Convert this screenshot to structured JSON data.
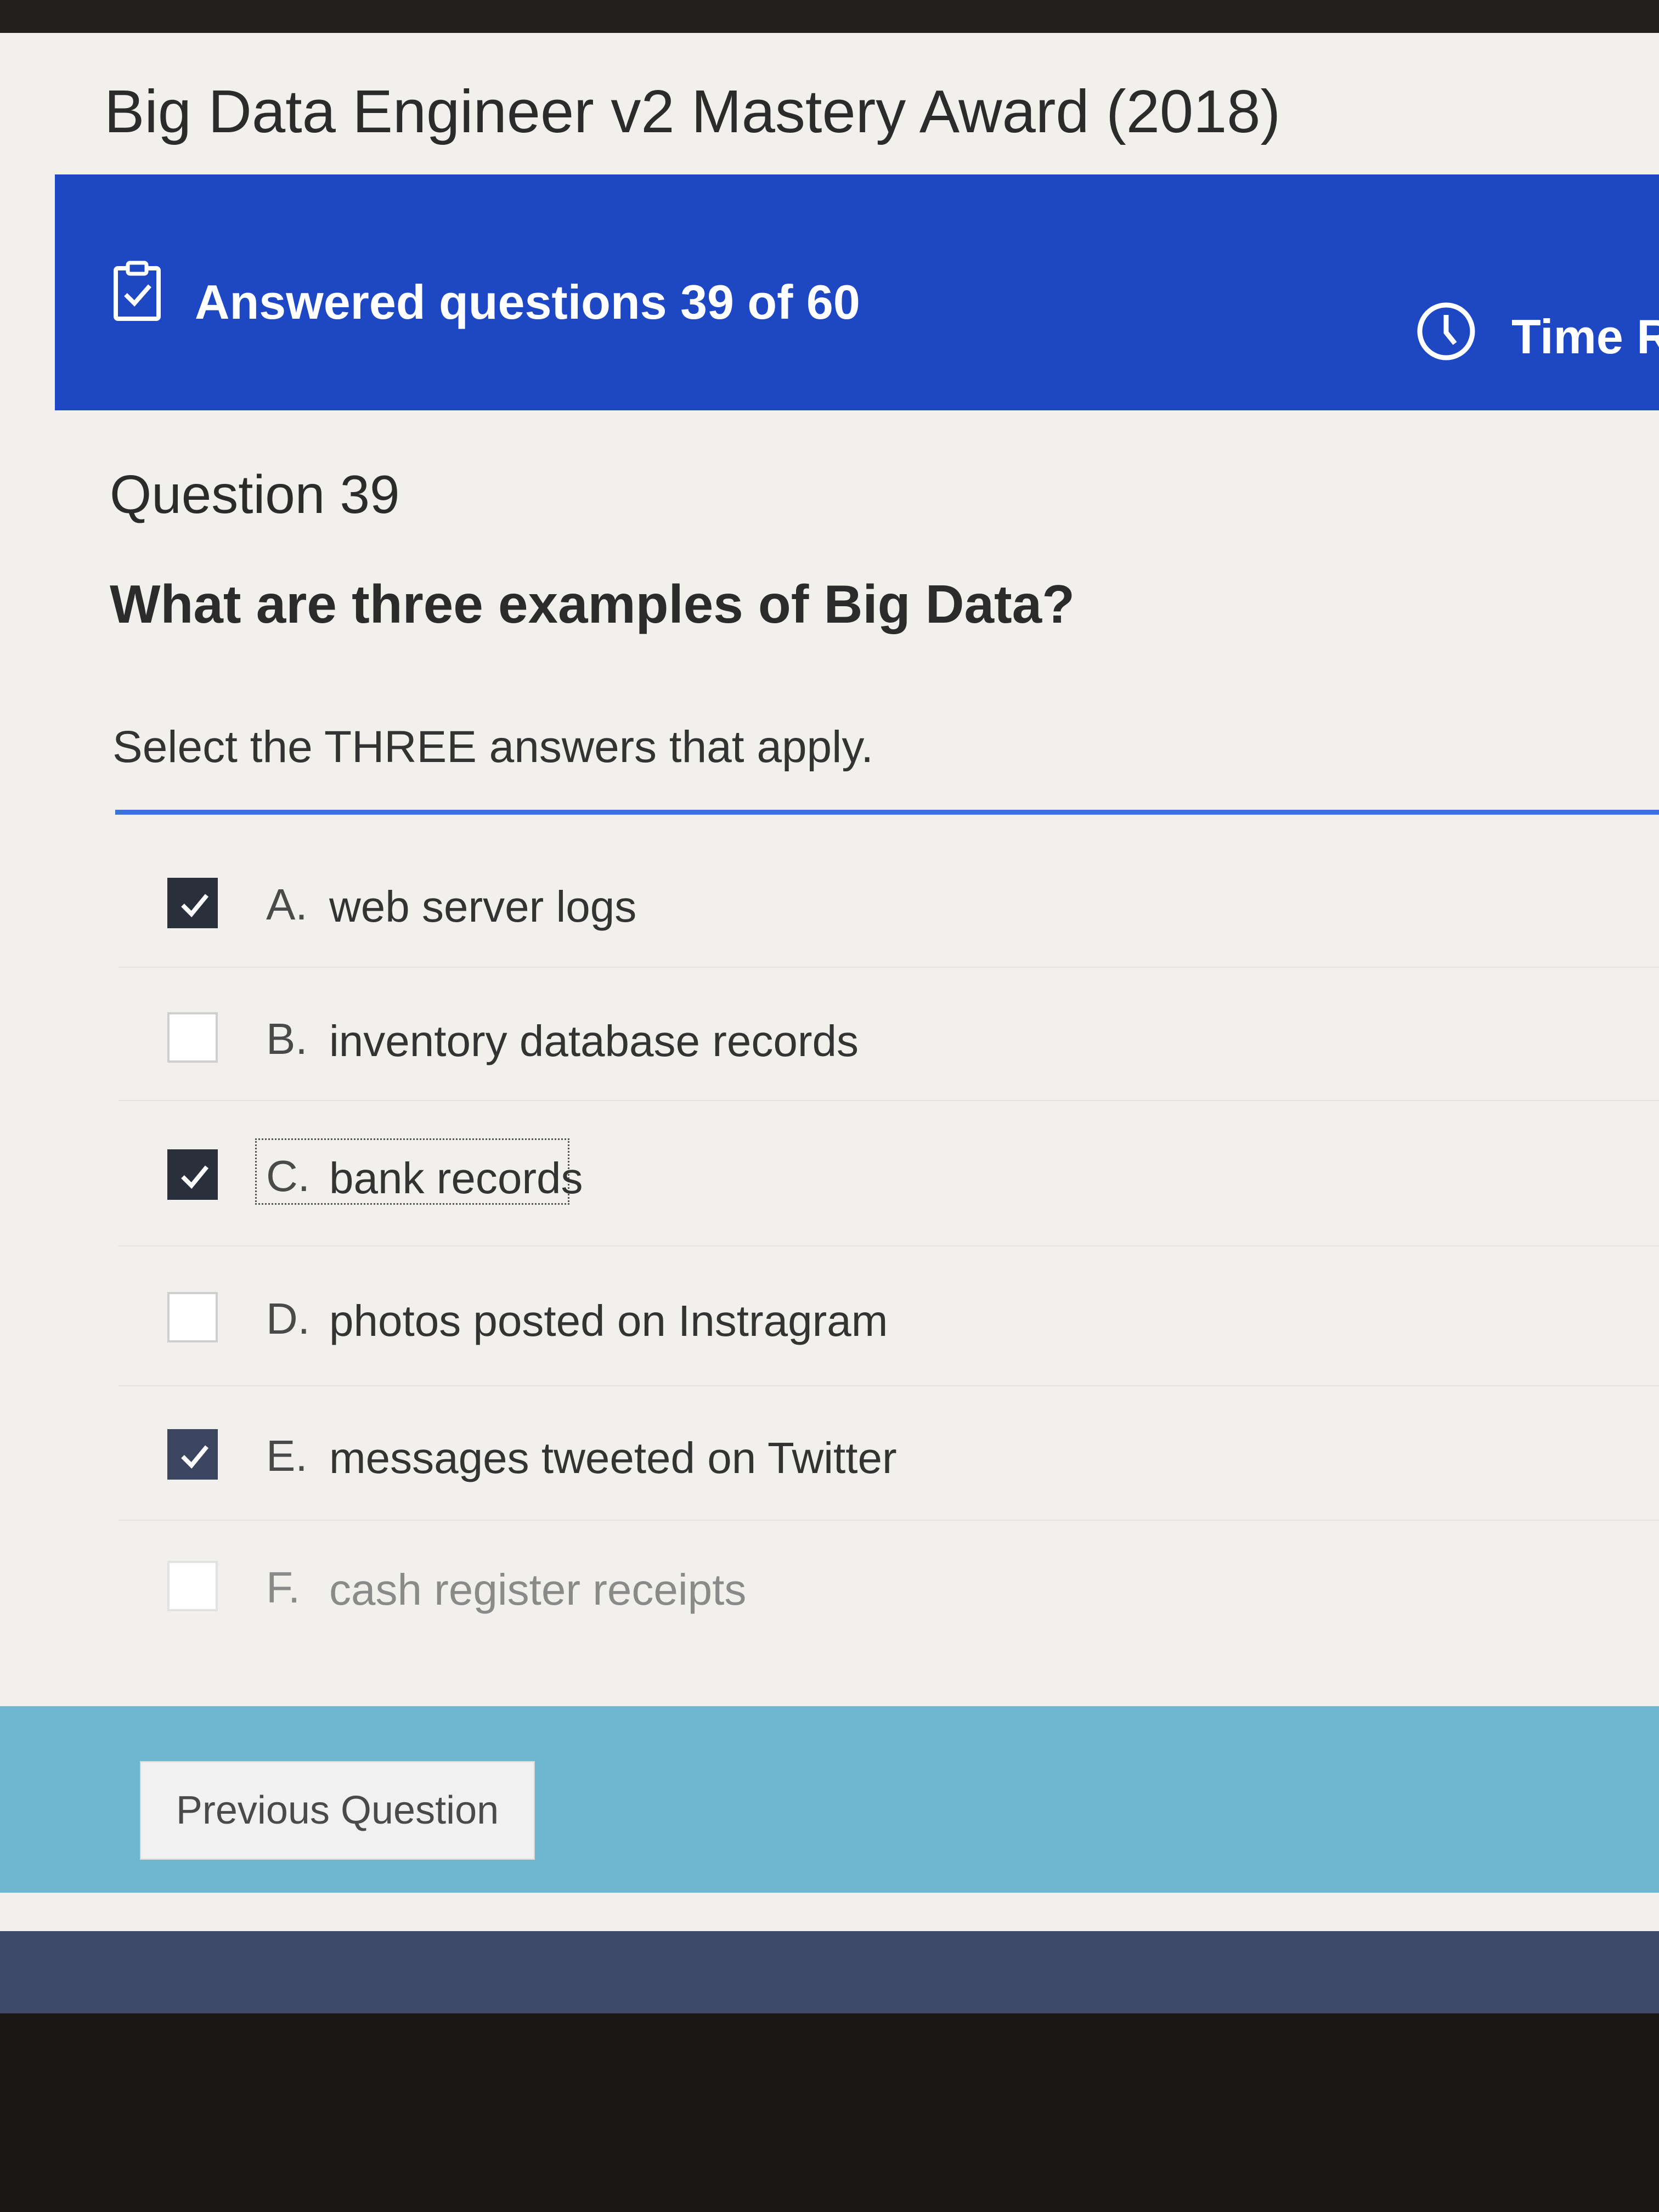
{
  "app": {
    "title": "Big Data Engineer v2 Mastery Award (2018)"
  },
  "progress": {
    "answered_text": "Answered questions 39 of 60",
    "answered": 39,
    "total": 60,
    "time_label": "Time R",
    "clipboard_icon": "clipboard-check-icon",
    "clock_icon": "clock-icon"
  },
  "question": {
    "number_label": "Question 39",
    "text": "What are three examples of Big Data?",
    "instruction": "Select the THREE answers that apply."
  },
  "options": [
    {
      "letter": "A.",
      "label": "web server logs",
      "checked": true
    },
    {
      "letter": "B.",
      "label": "inventory database records",
      "checked": false
    },
    {
      "letter": "C.",
      "label": "bank records",
      "checked": true,
      "focused": true
    },
    {
      "letter": "D.",
      "label": "photos posted on Instragram",
      "checked": false
    },
    {
      "letter": "E.",
      "label": "messages tweeted on Twitter",
      "checked": true
    },
    {
      "letter": "F.",
      "label": "cash register receipts",
      "checked": false
    }
  ],
  "footer": {
    "previous_label": "Previous Question"
  },
  "colors": {
    "banner": "#1e47c4",
    "accent_rule": "#3a74d6",
    "checked_box": "#2a2f3c",
    "footer": "#6fb7cf"
  }
}
